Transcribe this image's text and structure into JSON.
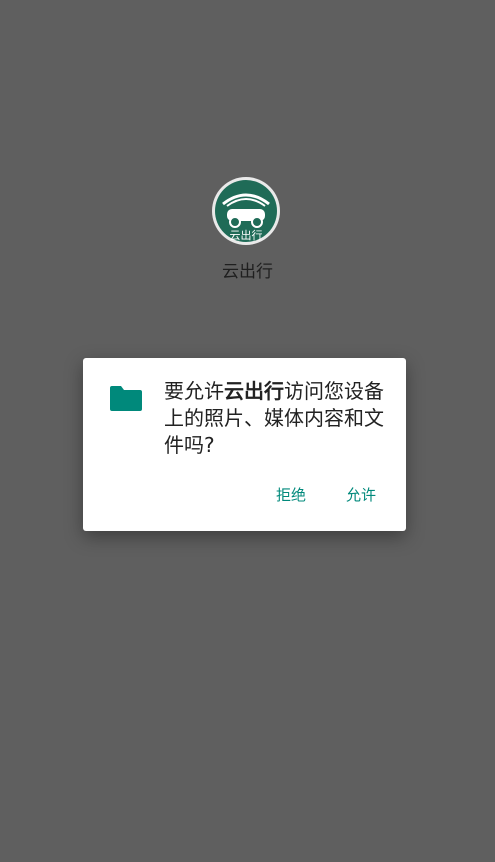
{
  "splash": {
    "app_name": "云出行",
    "logo_text": "云出行"
  },
  "permission_dialog": {
    "message_prefix": "要允许",
    "app_name": "云出行",
    "message_suffix": "访问您设备上的照片、媒体内容和文件吗?",
    "deny_label": "拒绝",
    "allow_label": "允许",
    "icon": "folder-icon"
  },
  "colors": {
    "scrim": "#5f5f5f",
    "accent": "#00897b",
    "logo_green": "#1f6b57"
  }
}
